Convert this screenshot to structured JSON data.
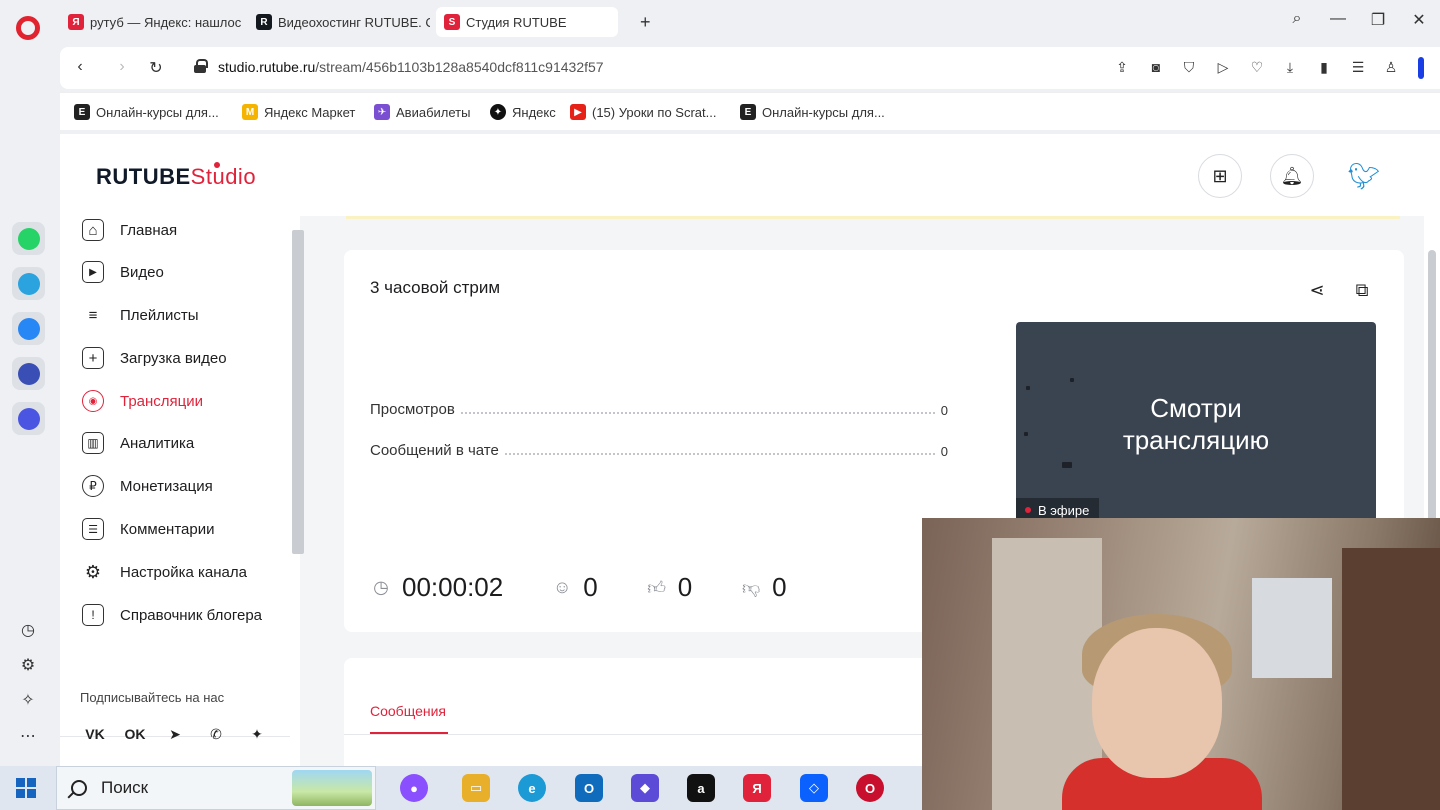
{
  "browser": {
    "tabs": [
      {
        "title": "рутуб — Яндекс: нашлось",
        "fav": "Я",
        "color": "#e0233b"
      },
      {
        "title": "Видеохостинг RUTUBE. Смотр",
        "fav": "R",
        "color": "#14191f"
      },
      {
        "title": "Студия RUTUBE",
        "fav": "S",
        "color": "#e0233b"
      }
    ],
    "url_host": "studio.rutube.ru",
    "url_path": "/stream/456b1103b128a8540dcf811c91432f57",
    "bookmarks": [
      {
        "label": "Онлайн-курсы для...",
        "fav": "E",
        "color": "#222"
      },
      {
        "label": "Яндекс Маркет",
        "fav": "M",
        "color": "#f5b400"
      },
      {
        "label": "Авиабилеты",
        "fav": "✈",
        "color": "#7a4fd1"
      },
      {
        "label": "Яндекс",
        "fav": "✦",
        "color": "#111"
      },
      {
        "label": "(15) Уроки по Scrat...",
        "fav": "▶",
        "color": "#e62117"
      },
      {
        "label": "Онлайн-курсы для...",
        "fav": "E",
        "color": "#222"
      }
    ]
  },
  "studio": {
    "logo_main": "RUTUBE",
    "logo_studio": "Studio",
    "nav": [
      {
        "label": "Главная",
        "icon": "⌂",
        "active": false
      },
      {
        "label": "Видео",
        "icon": "▶",
        "active": false
      },
      {
        "label": "Плейлисты",
        "icon": "≡",
        "active": false
      },
      {
        "label": "Загрузка видео",
        "icon": "+",
        "active": false
      },
      {
        "label": "Трансляции",
        "icon": "◉",
        "active": true
      },
      {
        "label": "Аналитика",
        "icon": "▥",
        "active": false
      },
      {
        "label": "Монетизация",
        "icon": "₽",
        "active": false
      },
      {
        "label": "Комментарии",
        "icon": "☰",
        "active": false
      },
      {
        "label": "Настройка канала",
        "icon": "⚙",
        "active": false
      },
      {
        "label": "Справочник блогера",
        "icon": "!",
        "active": false
      }
    ],
    "follow_title": "Подписывайтесь на нас",
    "social": [
      "VK",
      "OK",
      "➤",
      "✆",
      "✦"
    ]
  },
  "stream": {
    "title": "3 часовой стрим",
    "stats": [
      {
        "label": "Просмотров",
        "value": "0"
      },
      {
        "label": "Сообщений в чате",
        "value": "0"
      }
    ],
    "preview_line1": "Смотри",
    "preview_line2": "трансляцию",
    "live_badge": "В эфире",
    "duration": "00:00:02",
    "viewers": "0",
    "likes": "0",
    "dislikes": "0",
    "messages_tab": "Сообщения"
  },
  "taskbar": {
    "search_label": "Поиск",
    "apps": [
      {
        "name": "alice",
        "color": "#8a4fff",
        "glyph": "●"
      },
      {
        "name": "files",
        "color": "#e8b02a",
        "glyph": "▭"
      },
      {
        "name": "edge",
        "color": "#1b9ad6",
        "glyph": "e"
      },
      {
        "name": "outlook",
        "color": "#0f6cbd",
        "glyph": "O"
      },
      {
        "name": "copilot",
        "color": "#5b4bd6",
        "glyph": "◆"
      },
      {
        "name": "amazon",
        "color": "#111",
        "glyph": "a"
      },
      {
        "name": "yandex",
        "color": "#e0233b",
        "glyph": "Я"
      },
      {
        "name": "dropbox",
        "color": "#0a61fe",
        "glyph": "◇"
      },
      {
        "name": "opera",
        "color": "#c8102e",
        "glyph": "O"
      }
    ]
  }
}
